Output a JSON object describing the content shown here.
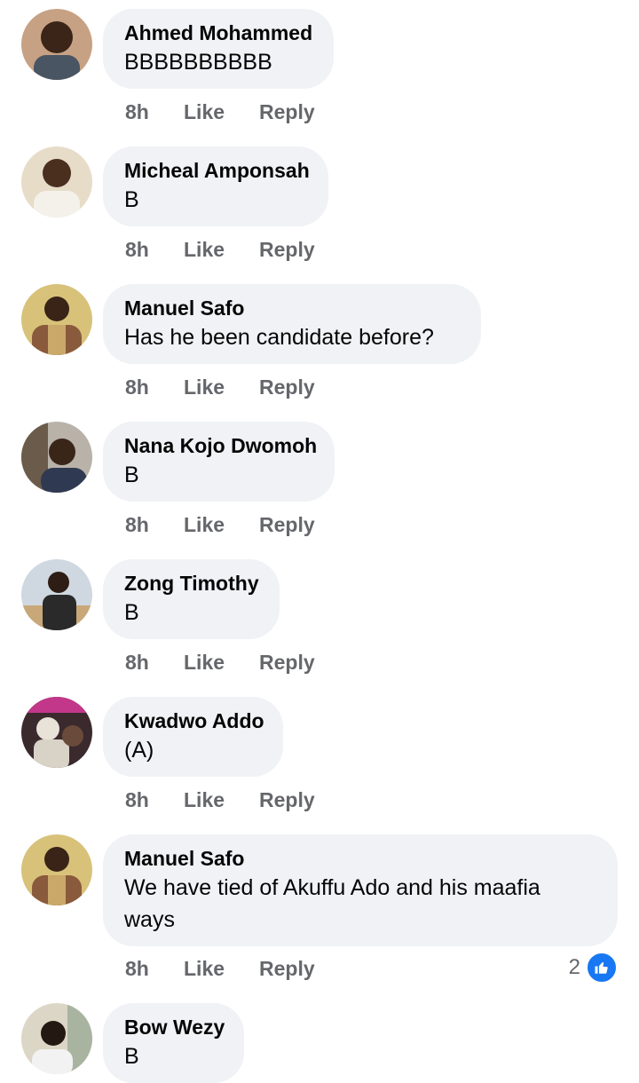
{
  "comments": [
    {
      "author": "Ahmed Mohammed",
      "text": "BBBBBBBBBB",
      "time": "8h",
      "like": "Like",
      "reply": "Reply"
    },
    {
      "author": "Micheal Amponsah",
      "text": "B",
      "time": "8h",
      "like": "Like",
      "reply": "Reply"
    },
    {
      "author": "Manuel Safo",
      "text": "Has he been candidate before?",
      "time": "8h",
      "like": "Like",
      "reply": "Reply"
    },
    {
      "author": "Nana Kojo Dwomoh",
      "text": "B",
      "time": "8h",
      "like": "Like",
      "reply": "Reply"
    },
    {
      "author": "Zong Timothy",
      "text": "B",
      "time": "8h",
      "like": "Like",
      "reply": "Reply"
    },
    {
      "author": "Kwadwo Addo",
      "text": "(A)",
      "time": "8h",
      "like": "Like",
      "reply": "Reply"
    },
    {
      "author": "Manuel Safo",
      "text": "We have tied of Akuffu Ado and his maafia ways",
      "time": "8h",
      "like": "Like",
      "reply": "Reply",
      "reaction_count": "2",
      "reaction_icon": "thumbs-up-icon"
    },
    {
      "author": "Bow Wezy",
      "text": "B"
    }
  ],
  "colors": {
    "bubble": "#f0f2f5",
    "author": "#050505",
    "meta": "#65676b",
    "like_badge": "#1877f2"
  }
}
